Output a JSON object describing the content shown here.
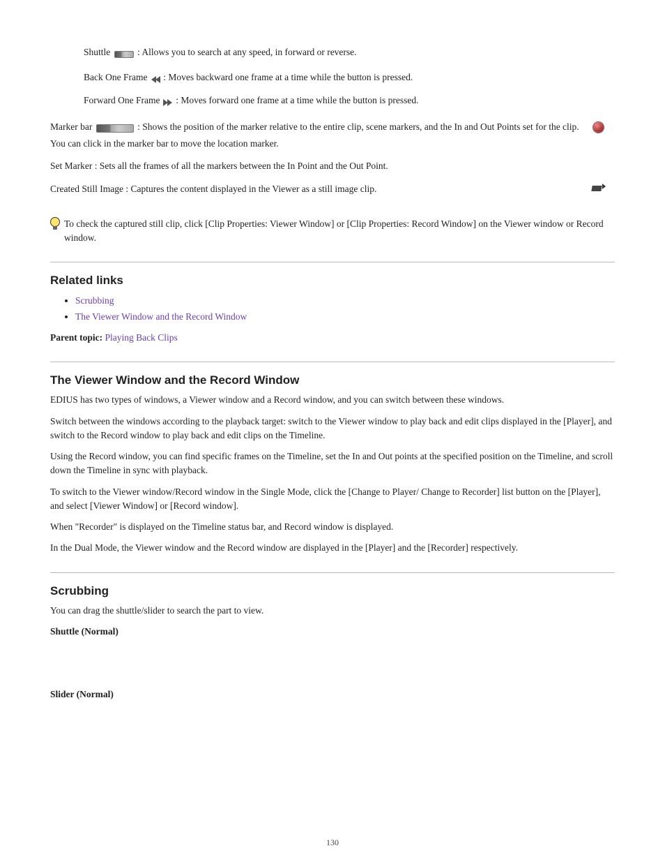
{
  "row1": {
    "pre": "Shuttle ",
    "post": ": Allows you to search at any speed, in forward or reverse."
  },
  "row2": {
    "pre": "Back One Frame ",
    "post": ": Moves backward one frame at a time while the button is pressed."
  },
  "row3": {
    "pre": "Forward One Frame ",
    "post": ": Moves forward one frame at a time while the button is pressed."
  },
  "group2": {
    "para1": {
      "pre": "Marker bar ",
      "post": ": Shows the position of the marker relative to the entire clip, scene markers, and the In and Out Points set for the clip. You can click in the marker bar to move the location marker."
    },
    "para2": {
      "pre": "Set Marker ",
      "post": ": Sets all the frames of all the markers between the In Point and the Out Point."
    },
    "para3": {
      "pre": "Created Still Image ",
      "post": ": Captures the content displayed in the Viewer as a still image clip."
    }
  },
  "tip": "To check the captured still clip, click [Clip Properties: Viewer Window] or [Clip Properties: Record Window] on the Viewer window or Record window.",
  "section2": {
    "heading": "Related links",
    "links": [
      "Scrubbing",
      "The Viewer Window and the Record Window"
    ],
    "parent": "Parent topic:",
    "parent_link": "Playing Back Clips"
  },
  "section3": {
    "heading": "The Viewer Window and the Record Window",
    "p1": "EDIUS has two types of windows, a Viewer window and a Record window, and you can switch between these windows.",
    "p2": "Switch between the windows according to the playback target: switch to the Viewer window to play back and edit clips displayed in the [Player], and switch to the Record window to play back and edit clips on the Timeline.",
    "p3": "Using the Record window, you can find specific frames on the Timeline, set the In and Out points at the specified position on the Timeline, and scroll down the Timeline in sync with playback.",
    "p4": "To switch to the Viewer window/Record window in the Single Mode, click the [Change to Player/ Change to Recorder] list button on the [Player], and select [Viewer Window] or [Record window].",
    "p5": "When \"Recorder\" is displayed on the Timeline status bar, and Record window is displayed.",
    "p6": "In the Dual Mode, the Viewer window and the Record window are displayed in the [Player] and the [Recorder] respectively."
  },
  "section4": {
    "heading": "Scrubbing",
    "p1": "You can drag the shuttle/slider to search the part to view.",
    "shuttle_label": "Shuttle (Normal)",
    "slider_label": "Slider (Normal)"
  },
  "page_number": "130"
}
